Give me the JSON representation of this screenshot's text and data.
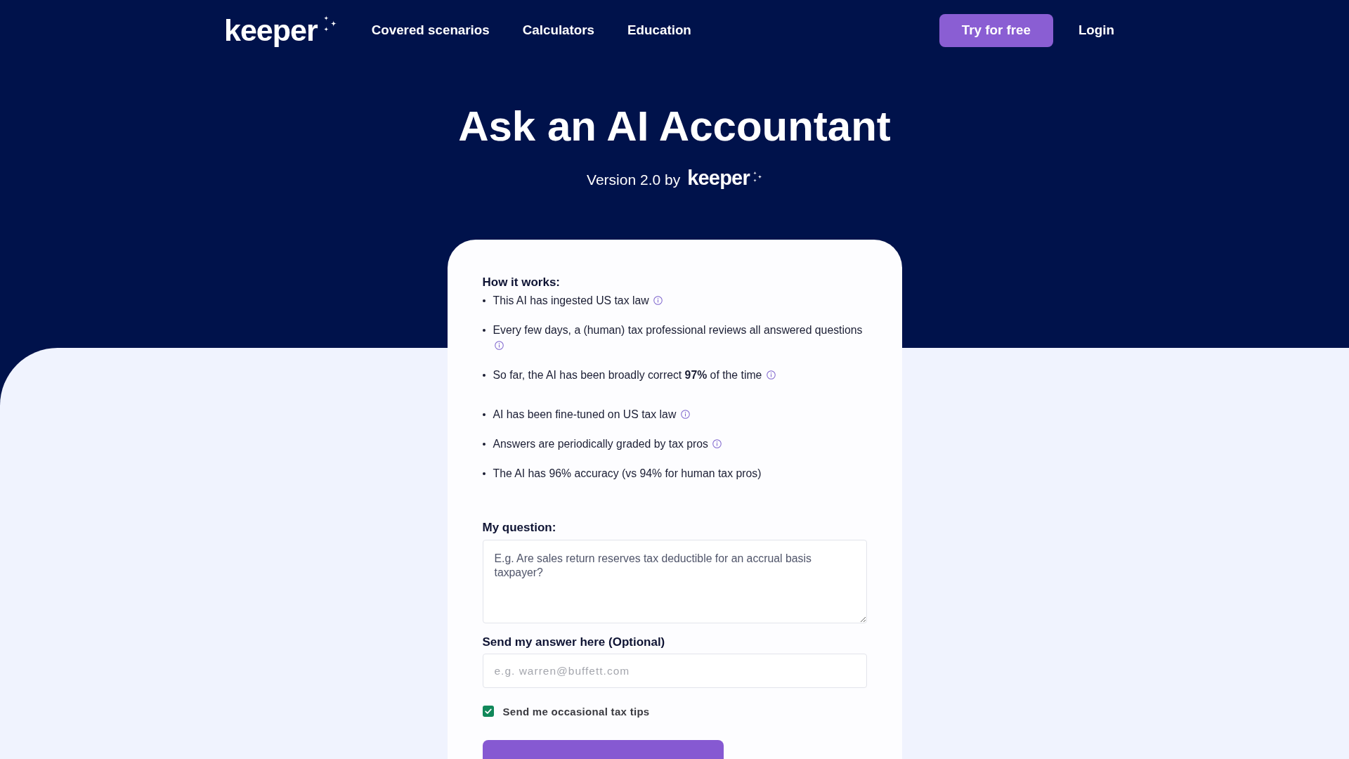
{
  "header": {
    "logo": "keeper",
    "nav": [
      "Covered scenarios",
      "Calculators",
      "Education"
    ],
    "actions": [
      {
        "label": "Try for free",
        "kind": "primary"
      },
      {
        "label": "Login",
        "kind": "link"
      }
    ]
  },
  "hero": {
    "title": "Ask an AI Accountant",
    "byline": "Version 2.0 by",
    "brand": "keeper"
  },
  "how_it_works": {
    "title": "How it works:",
    "groups": [
      {
        "items": [
          {
            "text": "This AI has ingested US tax law",
            "info": true
          },
          {
            "text": "Every few days, a (human) tax professional reviews all answered questions",
            "info": true
          },
          {
            "text": "So far, the AI has been broadly correct **97%** of the time",
            "info": true
          }
        ]
      },
      {
        "items": [
          {
            "text": "AI has been fine-tuned on US tax law",
            "info": true
          },
          {
            "text": "Answers are periodically graded by tax pros",
            "info": true
          },
          {
            "text": "The AI has 96% accuracy (vs 94% for human tax pros)",
            "info": false
          }
        ]
      }
    ]
  },
  "form": {
    "question": {
      "label": "My question:",
      "placeholder": "E.g. Are sales return reserves tax deductible for an accrual basis taxpayer?"
    },
    "email": {
      "label": "Send my answer here (Optional)",
      "placeholder": "e.g. warren@buffett.com"
    },
    "tips": {
      "label": "Send me occasional tax tips",
      "checked": true
    }
  }
}
